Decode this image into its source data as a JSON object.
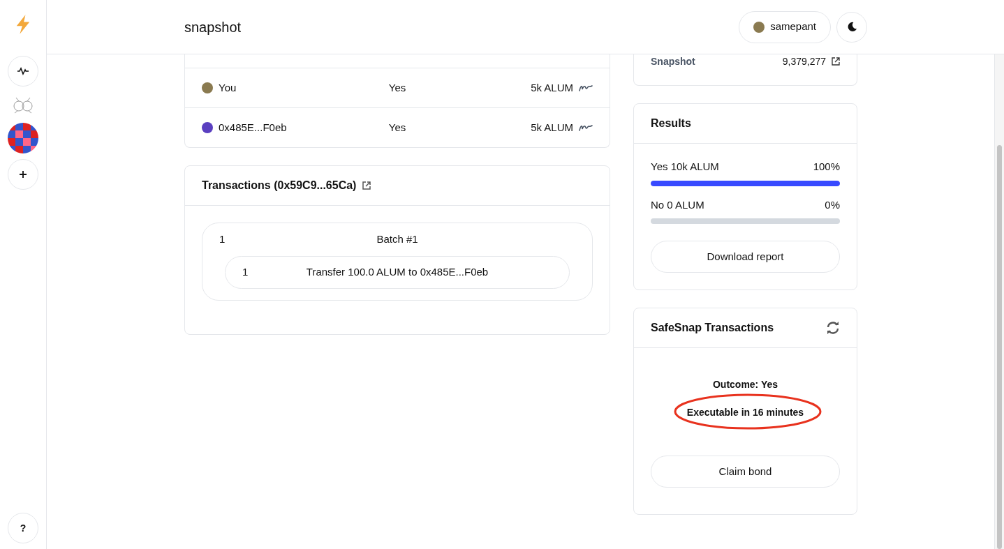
{
  "header": {
    "title": "snapshot",
    "user": "samepant"
  },
  "votes": [
    {
      "voter": "You",
      "choice": "Yes",
      "power": "5k ALUM"
    },
    {
      "voter": "0x485E...F0eb",
      "choice": "Yes",
      "power": "5k ALUM"
    }
  ],
  "help": "?",
  "transactions": {
    "title": "Transactions (0x59C9...65Ca)",
    "batches": [
      {
        "index": "1",
        "label": "Batch #1",
        "items": [
          {
            "index": "1",
            "label": "Transfer 100.0 ALUM to 0x485E...F0eb"
          }
        ]
      }
    ]
  },
  "info": {
    "label": "Snapshot",
    "value": "9,379,277"
  },
  "results": {
    "title": "Results",
    "choices": [
      {
        "label": "Yes 10k ALUM",
        "percent": "100%",
        "level": 1
      },
      {
        "label": "No 0 ALUM",
        "percent": "0%",
        "level": 0
      }
    ],
    "button": "Download report"
  },
  "safesnap": {
    "title": "SafeSnap Transactions",
    "outcome": "Outcome: Yes",
    "status": "Executable in 16 minutes",
    "highlighted": true,
    "button": "Claim bond"
  }
}
